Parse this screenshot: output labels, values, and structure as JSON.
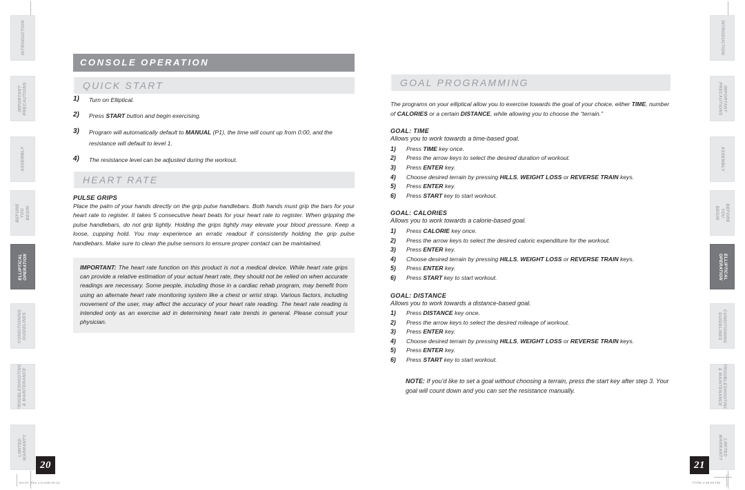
{
  "document": {
    "title": "CONSOLE OPERATION",
    "footer_left": "EX-67_Rev 1.6.indd   20-21",
    "footer_right": "7/7/08   4:29:26 PM",
    "page_left": "20",
    "page_right": "21"
  },
  "tabs": {
    "active": "ELLIPTICAL\nOPERATION",
    "items": [
      "INTRODUCTION",
      "IMPORTANT\nPRECAUTIONS",
      "ASSEMBLY",
      "BEFORE\nYOU BEGIN",
      "ELLIPTICAL\nOPERATION",
      "CONDITIONING\nGUIDELINES",
      "TROUBLESHOOTING\n& MAINTENANCE",
      "LIMITED\nWARRANTY"
    ]
  },
  "left_page": {
    "section_title": "CONSOLE OPERATION",
    "quick_start": {
      "heading": "QUICK START",
      "steps": [
        {
          "num": "1)",
          "html": "Turn on Elliptical."
        },
        {
          "num": "2)",
          "html": "Press <b>START</b> button and begin exercising."
        },
        {
          "num": "3)",
          "html": "Program will automatically default to <b>MANUAL</b> (P1), the time will count up from 0:00, and the resistance will default to level 1."
        },
        {
          "num": "4)",
          "html": "The resistance level can be adjusted during the workout."
        }
      ]
    },
    "heart_rate": {
      "heading": "HEART RATE",
      "pulse_grips_head": "PULSE GRIPS",
      "pulse_grips_body": "Place the palm of your hands directly on the grip pulse handlebars. Both hands must grip the bars for your heart rate to register. It takes 5 consecutive heart beats for your heart rate to register. When gripping the pulse handlebars, do not grip tightly. Holding the grips tightly may elevate your blood pressure. Keep a loose, cupping hold. You may experience an erratic readout if consistently holding the grip pulse handlebars. Make sure to clean the pulse sensors to ensure proper contact can be maintained.",
      "important_label": "IMPORTANT:",
      "important_body": "The heart rate function on this product is not a medical device. While heart rate grips can provide a relative estimation of your actual heart rate, they should not be relied on when accurate readings are necessary. Some people, including those in a cardiac rehab program, may benefit from using an alternate heart rate monitoring system like a chest or wrist strap. Various factors, including movement of the user, may affect the accuracy of your heart rate reading. The heart rate reading is intended only as an exercise aid in determining heart rate trends in general.  Please consult your physician."
    }
  },
  "right_page": {
    "goal_programming": {
      "heading": "GOAL PROGRAMMING",
      "intro_html": "The programs on your elliptical allow you to exercise towards the goal of your choice, either <b>TIME</b>, number of <b>CALORIES</b> or a certain <b>DISTANCE</b>, while allowing you to choose the “terrain.”",
      "goals": [
        {
          "head": "GOAL:  TIME",
          "desc": "Allows you to work towards a time-based goal.",
          "steps": [
            {
              "num": "1)",
              "html": "Press <b>TIME</b> key once."
            },
            {
              "num": "2)",
              "html": "Press the arrow keys to select the desired duration of workout."
            },
            {
              "num": "3)",
              "html": "Press <b>ENTER</b> key."
            },
            {
              "num": "4)",
              "html": "Choose desired terrain by pressing <b>HILLS</b>, <b>WEIGHT LOSS</b> or <b>REVERSE TRAIN</b> keys."
            },
            {
              "num": "5)",
              "html": "Press <b>ENTER</b> key."
            },
            {
              "num": "6)",
              "html": "Press <b>START</b> key to start workout."
            }
          ]
        },
        {
          "head": "GOAL:  CALORIES",
          "desc": "Allows you to work towards a calorie-based goal.",
          "steps": [
            {
              "num": "1)",
              "html": "Press <b>CALORIE</b> key once."
            },
            {
              "num": "2)",
              "html": "Press the arrow keys to select the desired caloric expenditure for the workout."
            },
            {
              "num": "3)",
              "html": "Press <b>ENTER</b> key."
            },
            {
              "num": "4)",
              "html": "Choose desired terrain by pressing <b>HILLS</b>, <b>WEIGHT LOSS</b> or <b>REVERSE TRAIN</b> keys."
            },
            {
              "num": "5)",
              "html": "Press <b>ENTER</b> key."
            },
            {
              "num": "6)",
              "html": "Press <b>START</b> key to start workout."
            }
          ]
        },
        {
          "head": "GOAL:  DISTANCE",
          "desc": "Allows you to work towards a distance-based goal.",
          "steps": [
            {
              "num": "1)",
              "html": "Press <b>DISTANCE</b> key once."
            },
            {
              "num": "2)",
              "html": "Press the arrow keys to select the desired mileage of workout."
            },
            {
              "num": "3)",
              "html": "Press <b>ENTER</b> key."
            },
            {
              "num": "4)",
              "html": "Choose desired terrain by pressing <b>HILLS</b>, <b>WEIGHT LOSS</b> or <b>REVERSE TRAIN</b> keys."
            },
            {
              "num": "5)",
              "html": "Press <b>ENTER</b> key."
            },
            {
              "num": "6)",
              "html": "Press <b>START</b> key to start workout."
            }
          ]
        }
      ],
      "note_label": "NOTE:",
      "note_body": "If you’d like to set a goal without choosing a terrain, press the start key after step 3. Your goal will count down and you can set the resistance manually."
    }
  },
  "colors": {
    "band_main_bg": "#939598",
    "band_sub_bg": "#e6e7e9",
    "tab_bg": "#e7e8ea",
    "tab_active_bg": "#77787b",
    "text": "#231f20",
    "page_badge_bg": "#231f20"
  }
}
